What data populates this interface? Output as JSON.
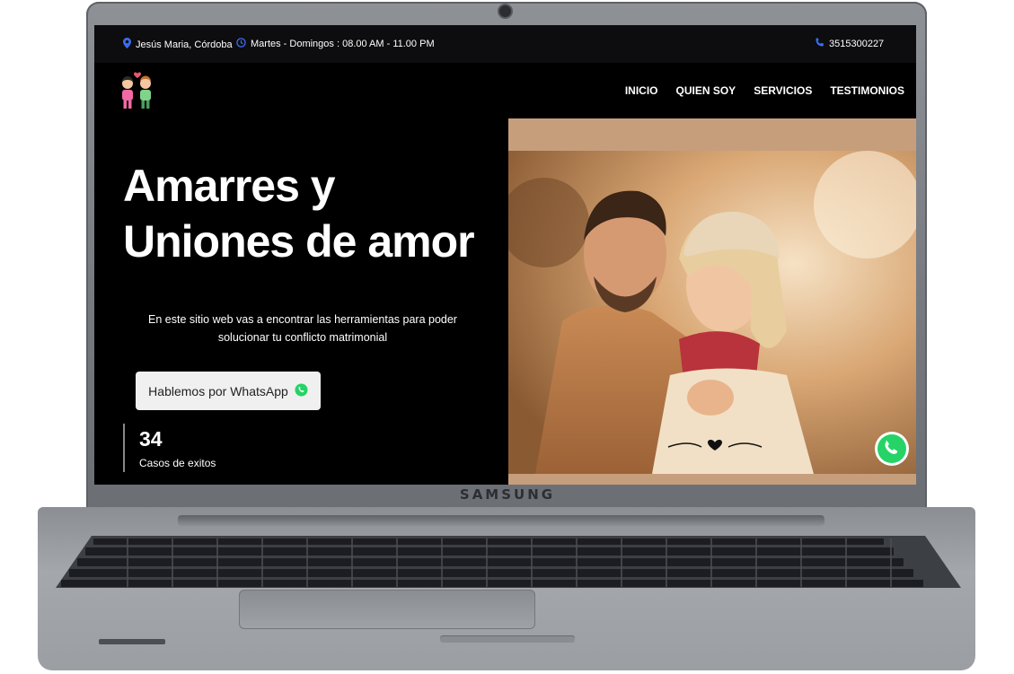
{
  "topbar": {
    "location": "Jesús Maria, Córdoba",
    "hours": "Martes - Domingos : 08.00 AM - 11.00 PM",
    "phone": "3515300227",
    "location_icon": "map-pin-icon",
    "clock_icon": "clock-icon",
    "phone_icon": "phone-icon"
  },
  "nav": {
    "items": [
      "INICIO",
      "QUIEN SOY",
      "SERVICIOS",
      "TESTIMONIOS"
    ]
  },
  "hero": {
    "title_line1": "Amarres y",
    "title_line2": "Uniones de amor",
    "description": "En este sitio web vas a encontrar las herramientas para poder solucionar tu conflicto matrimonial",
    "cta_label": "Hablemos por WhatsApp",
    "cta_icon": "whatsapp-icon"
  },
  "stats": {
    "count": "34",
    "label": "Casos de exitos"
  },
  "laptop": {
    "brand": "SAMSUNG"
  },
  "colors": {
    "accent_blue": "#3b6cf2",
    "whatsapp_green": "#25d366",
    "photo_frame": "#c79e7c",
    "background": "#000000"
  }
}
